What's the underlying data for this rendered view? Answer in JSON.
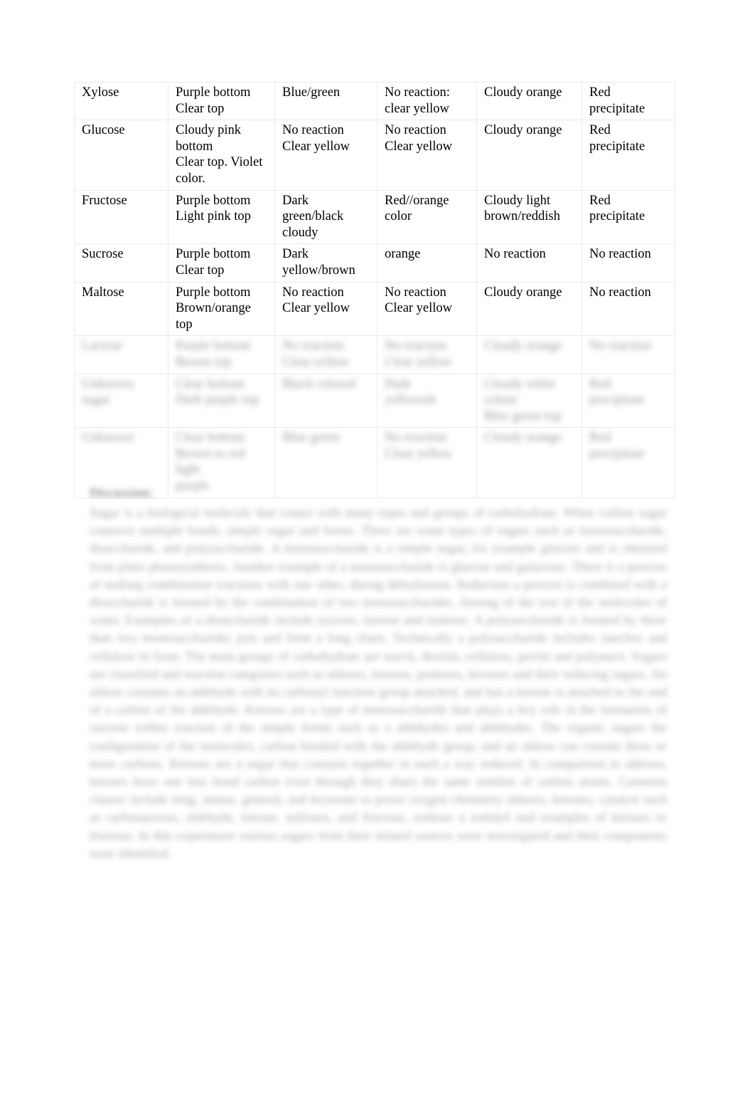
{
  "document": {
    "background_color": "#ffffff",
    "text_color": "#000000"
  },
  "table": {
    "name": "carbohydrate-test-results-table",
    "border_color": "#eceaea",
    "columns": 6,
    "rows": [
      {
        "legible": true,
        "cells": [
          [
            "Xylose"
          ],
          [
            "Purple bottom",
            "Clear top"
          ],
          [
            "Blue/green"
          ],
          [
            "No reaction:",
            "clear yellow"
          ],
          [
            "Cloudy orange"
          ],
          [
            "Red",
            "precipitate"
          ]
        ]
      },
      {
        "legible": true,
        "cells": [
          [
            "Glucose"
          ],
          [
            "Cloudy pink",
            "bottom",
            "Clear top. Violet",
            "color."
          ],
          [
            "No reaction",
            "Clear yellow"
          ],
          [
            "No reaction",
            "Clear yellow"
          ],
          [
            "Cloudy orange"
          ],
          [
            "Red",
            "precipitate"
          ]
        ]
      },
      {
        "legible": true,
        "cells": [
          [
            "Fructose"
          ],
          [
            "Purple bottom",
            "Light pink top"
          ],
          [
            "Dark",
            "green/black",
            "cloudy"
          ],
          [
            "Red//orange",
            "color"
          ],
          [
            "Cloudy light",
            "brown/reddish"
          ],
          [
            "Red",
            "precipitate"
          ]
        ]
      },
      {
        "legible": true,
        "cells": [
          [
            "Sucrose"
          ],
          [
            "Purple bottom",
            "Clear top"
          ],
          [
            "Dark",
            "yellow/brown"
          ],
          [
            "orange"
          ],
          [
            "No reaction"
          ],
          [
            "No reaction"
          ]
        ]
      },
      {
        "legible": true,
        "cells": [
          [
            "Maltose"
          ],
          [
            "Purple bottom",
            "Brown/orange",
            "top"
          ],
          [
            "No reaction",
            "Clear yellow"
          ],
          [
            "No reaction",
            "Clear yellow"
          ],
          [
            "Cloudy orange"
          ],
          [
            "No reaction"
          ]
        ]
      },
      {
        "legible": false,
        "cells": [
          [
            "Lactose"
          ],
          [
            "Purple bottom",
            "Brown top"
          ],
          [
            "No reaction",
            "Clear yellow"
          ],
          [
            "No reaction",
            "Clear yellow"
          ],
          [
            "Cloudy orange"
          ],
          [
            "No reaction"
          ]
        ]
      },
      {
        "legible": false,
        "cells": [
          [
            "Unknown",
            "sugar"
          ],
          [
            "Clear bottom",
            "Dark purple top"
          ],
          [
            "Black colored"
          ],
          [
            "Dark",
            "yellowish"
          ],
          [
            "Cloudy white",
            "colour",
            "Blue green top"
          ],
          [
            "Red",
            "precipitate"
          ]
        ]
      },
      {
        "legible": false,
        "cells": [
          [
            "Unknown"
          ],
          [
            "Clear bottom",
            "Brown to red light",
            "purple"
          ],
          [
            "Blue green"
          ],
          [
            "No reaction",
            "Clear yellow"
          ],
          [
            "Cloudy orange"
          ],
          [
            "Red",
            "precipitate"
          ]
        ]
      }
    ]
  },
  "discussion": {
    "legible": false,
    "heading": "Discussion:",
    "body": "Sugar is a biological molecule that comes with many types and groups of carbohydrate. When carbon sugar connects multiple bonds, simple sugar and forms. There are some types of sugars such as monosaccharide, disaccharide, and polysaccharide. A monosaccharide is a simple sugar, for example glucose and is obtained from plain photosynthesis. Another example of a monosaccharide is glucose and galactose. There is a process of making combination reactions with one other, during dehydration. Reduction a process is combined with a disaccharide is formed by the combination of two monosaccharides. Among of the rest of the molecules of water. Examples of a disaccharide include sucrose, lactose and maltose. A polysaccharide is formed by three than two monosaccharides join and form a long chain. Technically a polysaccharide includes starches and cellulose in form. The main groups of carbohydrate are starch, dextrin, cellulose, pectin and polymers. Sugars are classified and reaction categories such as aldoses, ketoses, pentoses, hexoses and their reducing sugars. An aldose contains an aldehyde with its carbonyl function group attached, and has a ketone is attached to the end of a carbon of the aldehyde. Ketoses are a type of monosaccharide that plays a key role in the formation of sucrose within reaction of the simple forms such as a aldehydes and aldehydes. The organic sugars the configuration of the molecules, carbon bonded with the aldehyde group, and an aldose can contain three or more carbons. Ketoses are a sugar that contains together in such a way reduced. In comparison to aldoses, ketoses have one less bond carbon even through they share the same number of carbon atoms. Common classes include long, amino, general, and keystone to prove oxygen chemistry aldoses, ketones, catalyst such as carbonaceous, aldehyde, ketone, sulfones, and fructose, sorbose a sorbitol and examples of ketoses or fructose. In this experiment various sugars from their related sources were investigated and their components were identified."
  }
}
